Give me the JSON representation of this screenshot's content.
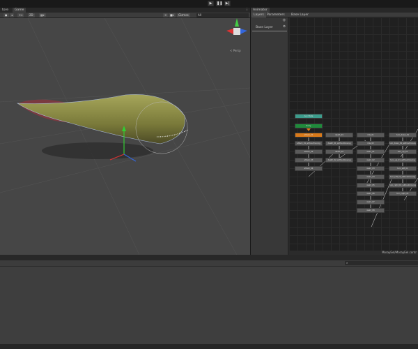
{
  "toolbar": {
    "play_icon": "play-icon",
    "pause_icon": "pause-icon",
    "step_icon": "step-icon"
  },
  "scene": {
    "tabs": [
      {
        "label": "tore"
      },
      {
        "label": "Game"
      }
    ],
    "gizmos_label": "Gizmos",
    "search_placeholder": "All",
    "toggle_2d": "2D",
    "projection_label": "< Persp"
  },
  "animator": {
    "tab_label": "Animator",
    "layers_tab": "Layers",
    "parameters_tab": "Parameters",
    "breadcrumb": "Base Layer",
    "layer_name": "Base Layer",
    "footer_path": "MorayEel/MorayEel.contr",
    "colors": {
      "any_state": "#3d9c8c",
      "entry": "#1f8a3b",
      "default": "#d97a1a",
      "state": "#5a5a5a"
    },
    "special_states": [
      {
        "label": "Any State"
      },
      {
        "label": "Entry"
      }
    ],
    "columns": [
      [
        "attack_01",
        "attack_01_withoutmoving",
        "attack_02",
        "attack_03",
        "attack_04"
      ],
      [
        "death_01",
        "death_01_withoutmoving",
        "death_02",
        "death_02_withoutmoving"
      ],
      [
        "idle_01",
        "idle_02",
        "swim_01",
        "swim_02",
        "swim_03",
        "swim_04",
        "swim_05",
        "swim_06",
        "swim_07",
        "swim_08"
      ],
      [
        "turn_down_01",
        "turn_down_01_withoutmoving",
        "turn_up_01",
        "turn_up_01_withoutmoving",
        "turn_left_01",
        "turn_left_01_withoutmoving",
        "turn_right_01_withoutmoving",
        "turn_right_01"
      ]
    ]
  }
}
